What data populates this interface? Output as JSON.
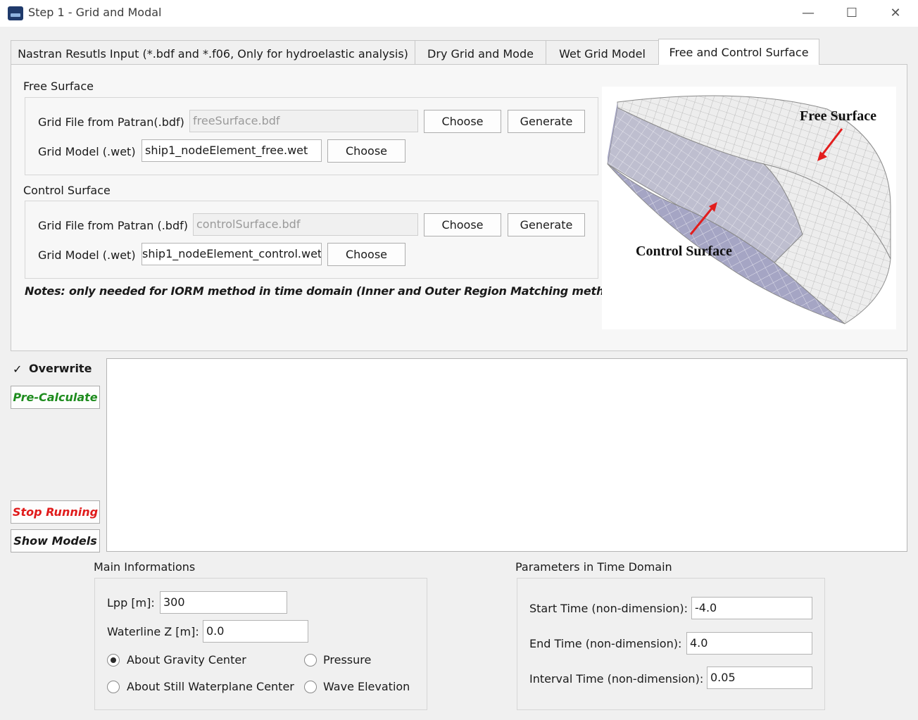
{
  "window": {
    "title": "Step 1 - Grid and Modal",
    "minimize_glyph": "—",
    "maximize_glyph": "☐",
    "close_glyph": "✕"
  },
  "tabs": [
    {
      "label": "Nastran Resutls Input (*.bdf and *.f06, Only for hydroelastic analysis)",
      "active": false
    },
    {
      "label": "Dry Grid and Mode",
      "active": false
    },
    {
      "label": "Wet Grid Model",
      "active": false
    },
    {
      "label": "Free and Control Surface",
      "active": true
    }
  ],
  "free_surface": {
    "title": "Free Surface",
    "grid_file_label": "Grid File from Patran(.bdf)",
    "grid_file_value": "freeSurface.bdf",
    "grid_model_label": "Grid Model (.wet)",
    "grid_model_value": "ship1_nodeElement_free.wet",
    "choose_label": "Choose",
    "generate_label": "Generate"
  },
  "control_surface": {
    "title": "Control Surface",
    "grid_file_label": "Grid File from Patran (.bdf)",
    "grid_file_value": "controlSurface.bdf",
    "grid_model_label": "Grid Model (.wet)",
    "grid_model_value": "ship1_nodeElement_control.wet",
    "choose_label": "Choose",
    "generate_label": "Generate"
  },
  "notes": "Notes: only needed for IORM method in time domain (Inner and Outer Region Matching method)",
  "illustration": {
    "free_surface_label": "Free Surface",
    "control_surface_label": "Control  Surface"
  },
  "sidebar": {
    "overwrite_label": "Overwrite",
    "overwrite_checked": true,
    "pre_calculate_label": "Pre-Calculate",
    "stop_running_label": "Stop Running",
    "show_models_label": "Show Models",
    "pre_calculate_color": "#1e8c1e",
    "stop_running_color": "#e01b1b"
  },
  "main_info": {
    "title": "Main Informations",
    "lpp_label": "Lpp [m]:",
    "lpp_value": "300",
    "waterline_label": "Waterline Z [m]:",
    "waterline_value": "0.0",
    "radio_gravity_label": "About Gravity Center",
    "radio_gravity_checked": true,
    "radio_waterplane_label": "About Still Waterplane Center",
    "radio_pressure_label": "Pressure",
    "radio_wave_label": "Wave Elevation"
  },
  "time_domain": {
    "title": "Parameters in Time Domain",
    "start_label": "Start Time (non-dimension):",
    "start_value": "-4.0",
    "end_label": "End Time (non-dimension):",
    "end_value": "4.0",
    "interval_label": "Interval Time (non-dimension):",
    "interval_value": "0.05"
  }
}
